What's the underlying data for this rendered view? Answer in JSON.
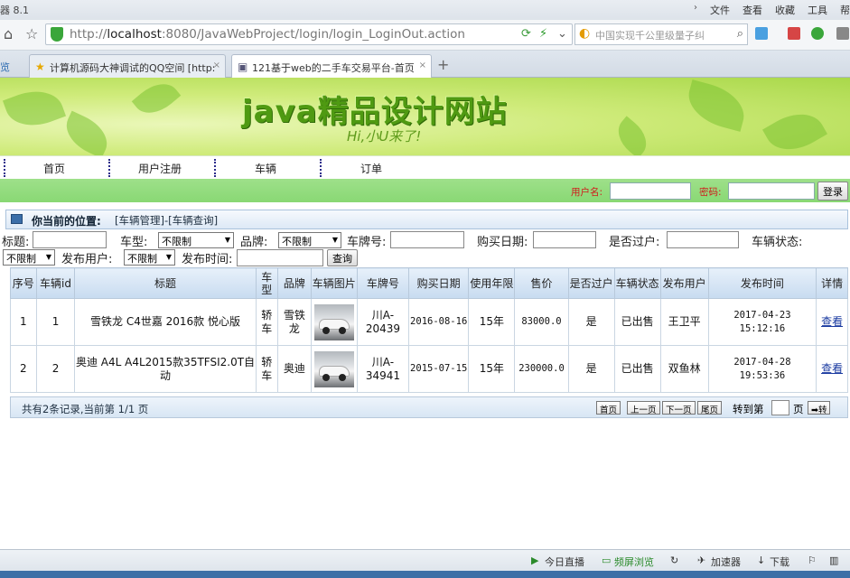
{
  "browser": {
    "app_title": "器 8.1",
    "menu": [
      "文件",
      "查看",
      "收藏",
      "工具",
      "帮"
    ],
    "url_host": "localhost",
    "url_rest": ":8080/JavaWebProject/login/login_LoginOut.action",
    "url_prefix": "http://",
    "search_text": "中国实现千公里级量子纠",
    "tab_first": "览",
    "tabs": [
      {
        "label": "计算机源码大神调试的QQ空间 [http:",
        "close": "×"
      },
      {
        "label": "121基于web的二手车交易平台-首页",
        "close": "×"
      }
    ]
  },
  "banner": {
    "title": "java精品设计网站",
    "subtitle": "Hi,小U来了!"
  },
  "nav": {
    "items": [
      "首页",
      "用户注册",
      "车辆",
      "订单"
    ]
  },
  "login": {
    "username_label": "用户名:",
    "password_label": "密码:",
    "button": "登录"
  },
  "position": {
    "label": "你当前的位置:",
    "path": "[车辆管理]-[车辆查询]"
  },
  "filters": {
    "title_label": "标题:",
    "type_label": "车型:",
    "type_value": "不限制",
    "brand_label": "品牌:",
    "brand_value": "不限制",
    "plate_label": "车牌号:",
    "buy_date_label": "购买日期:",
    "transferred_label": "是否过户:",
    "status_label": "车辆状态:",
    "status_value": "不限制",
    "publisher_label": "发布用户:",
    "publisher_value": "不限制",
    "publish_time_label": "发布时间:",
    "query_button": "查询"
  },
  "table": {
    "headers": [
      "序号",
      "车辆id",
      "标题",
      "车型",
      "品牌",
      "车辆图片",
      "车牌号",
      "购买日期",
      "使用年限",
      "售价",
      "是否过户",
      "车辆状态",
      "发布用户",
      "发布时间",
      "详情"
    ],
    "rows": [
      {
        "seq": "1",
        "id": "1",
        "title": "雪铁龙 C4世嘉 2016款 悦心版",
        "type": "轿车",
        "brand": "雪铁龙",
        "plate": "川A-20439",
        "buy_date": "2016-08-16",
        "years": "15年",
        "price": "83000.0",
        "transferred": "是",
        "status": "已出售",
        "publisher": "王卫平",
        "publish_time": "2017-04-23 15:12:16",
        "detail": "查看"
      },
      {
        "seq": "2",
        "id": "2",
        "title": "奥迪 A4L A4L2015款35TFSI2.0T自动",
        "type": "轿车",
        "brand": "奥迪",
        "plate": "川A-34941",
        "buy_date": "2015-07-15",
        "years": "15年",
        "price": "230000.0",
        "transferred": "是",
        "status": "已出售",
        "publisher": "双鱼林",
        "publish_time": "2017-04-28 19:53:36",
        "detail": "查看"
      }
    ]
  },
  "pager": {
    "summary": "共有2条记录,当前第 1/1 页",
    "first": "首页",
    "prev": "上一页",
    "next": "下一页",
    "last": "尾页",
    "goto_label": "转到第",
    "page_label": "页",
    "go": "➡转"
  },
  "statusbar": {
    "live": "今日直播",
    "screen": "频屏浏览",
    "speed": "加速器",
    "download": "下载"
  }
}
